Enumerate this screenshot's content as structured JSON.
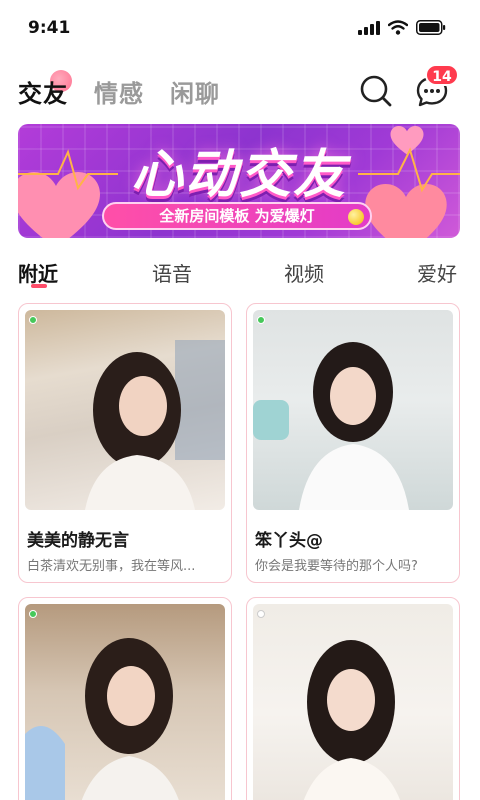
{
  "status_bar": {
    "time": "9:41"
  },
  "top_nav": {
    "tabs": [
      {
        "label": "交友",
        "active": true
      },
      {
        "label": "情感",
        "active": false
      },
      {
        "label": "闲聊",
        "active": false
      }
    ],
    "search_icon": "search-icon",
    "message_icon": "chat-bubble-icon",
    "message_badge": "14"
  },
  "banner": {
    "title": "心动交友",
    "subtitle": "全新房间模板 为爱爆灯"
  },
  "category_tabs": [
    {
      "label": "附近",
      "active": true
    },
    {
      "label": "语音",
      "active": false
    },
    {
      "label": "视频",
      "active": false
    },
    {
      "label": "爱好",
      "active": false
    }
  ],
  "cards": [
    {
      "name": "美美的静无言",
      "bio": "白茶清欢无别事，我在等风...",
      "online": true
    },
    {
      "name": "笨丫头@",
      "bio": "你会是我要等待的那个人吗?",
      "online": true
    },
    {
      "name": "",
      "bio": "",
      "online": true
    },
    {
      "name": "",
      "bio": "",
      "online": false
    }
  ],
  "colors": {
    "accent": "#ff4d6a",
    "badge": "#ff3b4e",
    "online": "#46c85a",
    "card_border": "#f7c6cf"
  }
}
